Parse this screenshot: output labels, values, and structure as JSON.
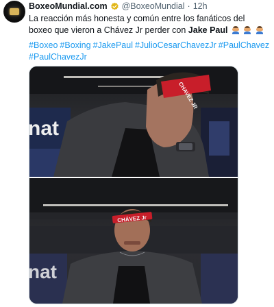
{
  "account": {
    "display_name": "BoxeoMundial.com",
    "handle": "@BoxeoMundial",
    "separator": "·",
    "time": "12h"
  },
  "tweet": {
    "text_main": "La reacción más honesta y común entre los fanáticos del boxeo que vieron a Chávez Jr perder con",
    "text_bold": "Jake Paul",
    "emoji_names": [
      "man-facepalming-emoji",
      "man-facepalming-emoji",
      "man-facepalming-emoji"
    ],
    "hashtags": [
      "#Boxeo",
      "#Boxing",
      "#JakePaul",
      "#JulioCesarChavezJr",
      "#PaulChavez",
      "#PaulChavezJr"
    ]
  },
  "media": {
    "headband_text_top": "CHAVEZ JR",
    "headband_text_bottom": "CHÁVEZ Jr",
    "arena_text": "nat"
  },
  "colors": {
    "link": "#1d9bf0",
    "text": "#0f1419",
    "secondary": "#536471",
    "verified": "#e2b719",
    "headband": "#c81e2a"
  }
}
